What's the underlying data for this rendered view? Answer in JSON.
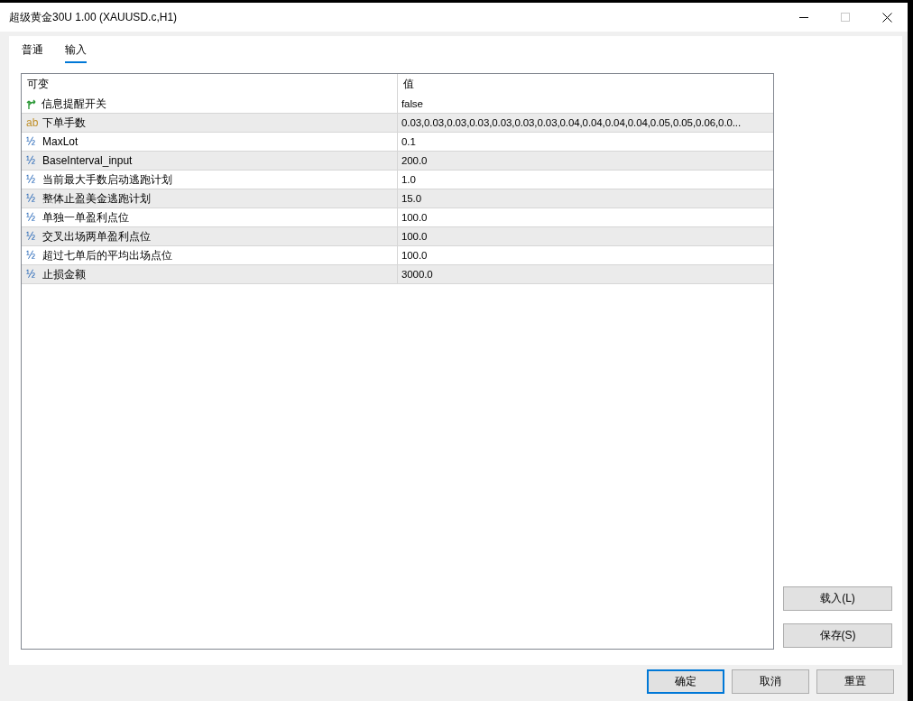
{
  "window": {
    "title": "超级黄金30U 1.00 (XAUUSD.c,H1)"
  },
  "tabs": [
    {
      "label": "普通",
      "selected": false
    },
    {
      "label": "输入",
      "selected": true
    }
  ],
  "table": {
    "columns": [
      "可变",
      "值"
    ],
    "rows": [
      {
        "kind": "bool",
        "name": "信息提醒开关",
        "value": "false"
      },
      {
        "kind": "string",
        "type_mark": "ab",
        "name": "下单手数",
        "value": "0.03,0.03,0.03,0.03,0.03,0.03,0.03,0.04,0.04,0.04,0.04,0.05,0.05,0.06,0.0..."
      },
      {
        "kind": "number",
        "type_mark": "½",
        "name": "MaxLot",
        "value": "0.1"
      },
      {
        "kind": "number",
        "type_mark": "½",
        "name": "BaseInterval_input",
        "value": "200.0"
      },
      {
        "kind": "number",
        "type_mark": "½",
        "name": "当前最大手数启动逃跑计划",
        "value": "1.0"
      },
      {
        "kind": "number",
        "type_mark": "½",
        "name": "整体止盈美金逃跑计划",
        "value": "15.0"
      },
      {
        "kind": "number",
        "type_mark": "½",
        "name": "单独一单盈利点位",
        "value": "100.0"
      },
      {
        "kind": "number",
        "type_mark": "½",
        "name": "交叉出场两单盈利点位",
        "value": "100.0"
      },
      {
        "kind": "number",
        "type_mark": "½",
        "name": "超过七单后的平均出场点位",
        "value": "100.0"
      },
      {
        "kind": "number",
        "type_mark": "½",
        "name": "止损金额",
        "value": "3000.0"
      }
    ]
  },
  "side_buttons": [
    "载入(L)",
    "保存(S)"
  ],
  "footer_buttons": [
    {
      "label": "确定",
      "default": true
    },
    {
      "label": "取消",
      "default": false
    },
    {
      "label": "重置",
      "default": false
    }
  ]
}
